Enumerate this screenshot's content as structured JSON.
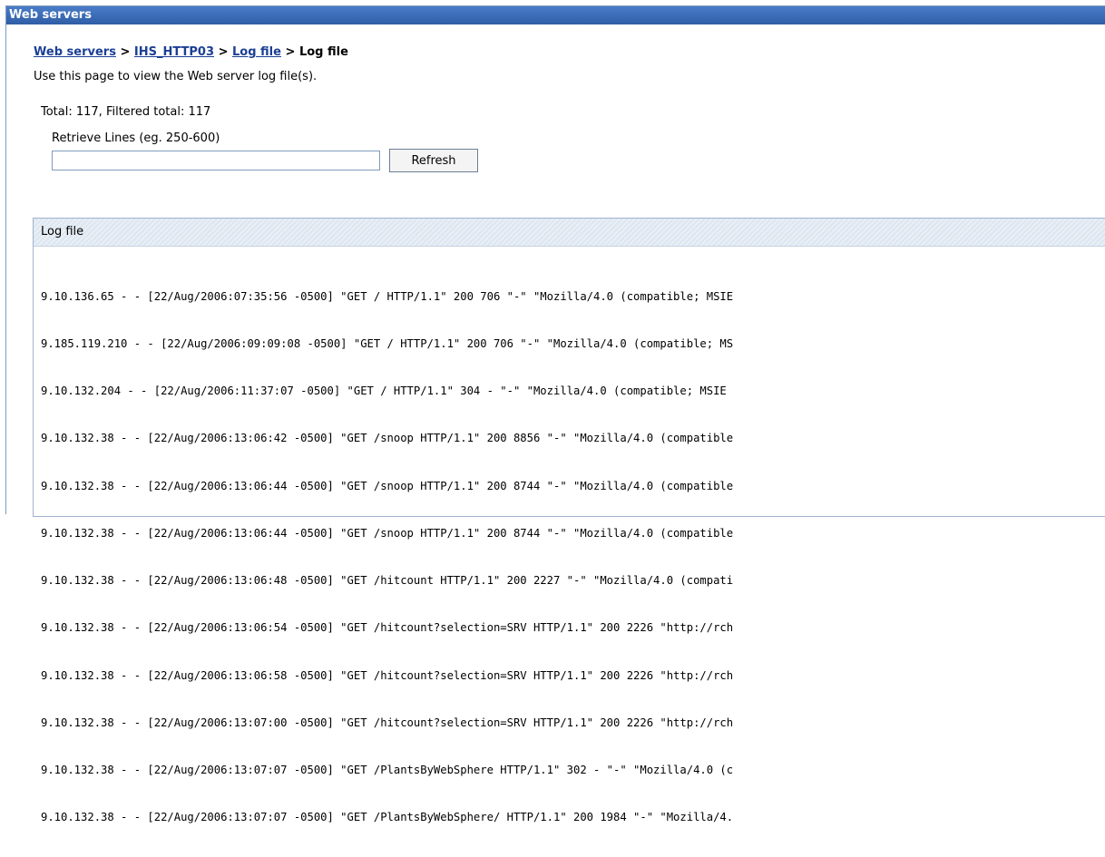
{
  "titlebar": {
    "title": "Web servers"
  },
  "breadcrumb": {
    "items": [
      "Web servers",
      "IHS_HTTP03",
      "Log file"
    ],
    "separator": ">",
    "current": "Log file"
  },
  "description": "Use this page to view the Web server log file(s).",
  "totals": "Total: 117, Filtered total: 117",
  "retrieve": {
    "label": "Retrieve Lines (eg. 250-600)",
    "value": "",
    "button": "Refresh"
  },
  "log_panel": {
    "header": "Log file",
    "lines": [
      "9.10.136.65 - - [22/Aug/2006:07:35:56 -0500] \"GET / HTTP/1.1\" 200 706 \"-\" \"Mozilla/4.0 (compatible; MSIE",
      "9.185.119.210 - - [22/Aug/2006:09:09:08 -0500] \"GET / HTTP/1.1\" 200 706 \"-\" \"Mozilla/4.0 (compatible; MS",
      "9.10.132.204 - - [22/Aug/2006:11:37:07 -0500] \"GET / HTTP/1.1\" 304 - \"-\" \"Mozilla/4.0 (compatible; MSIE",
      "9.10.132.38 - - [22/Aug/2006:13:06:42 -0500] \"GET /snoop HTTP/1.1\" 200 8856 \"-\" \"Mozilla/4.0 (compatible",
      "9.10.132.38 - - [22/Aug/2006:13:06:44 -0500] \"GET /snoop HTTP/1.1\" 200 8744 \"-\" \"Mozilla/4.0 (compatible",
      "9.10.132.38 - - [22/Aug/2006:13:06:44 -0500] \"GET /snoop HTTP/1.1\" 200 8744 \"-\" \"Mozilla/4.0 (compatible",
      "9.10.132.38 - - [22/Aug/2006:13:06:48 -0500] \"GET /hitcount HTTP/1.1\" 200 2227 \"-\" \"Mozilla/4.0 (compati",
      "9.10.132.38 - - [22/Aug/2006:13:06:54 -0500] \"GET /hitcount?selection=SRV HTTP/1.1\" 200 2226 \"http://rch",
      "9.10.132.38 - - [22/Aug/2006:13:06:58 -0500] \"GET /hitcount?selection=SRV HTTP/1.1\" 200 2226 \"http://rch",
      "9.10.132.38 - - [22/Aug/2006:13:07:00 -0500] \"GET /hitcount?selection=SRV HTTP/1.1\" 200 2226 \"http://rch",
      "9.10.132.38 - - [22/Aug/2006:13:07:07 -0500] \"GET /PlantsByWebSphere HTTP/1.1\" 302 - \"-\" \"Mozilla/4.0 (c",
      "9.10.132.38 - - [22/Aug/2006:13:07:07 -0500] \"GET /PlantsByWebSphere/ HTTP/1.1\" 200 1984 \"-\" \"Mozilla/4."
    ]
  }
}
